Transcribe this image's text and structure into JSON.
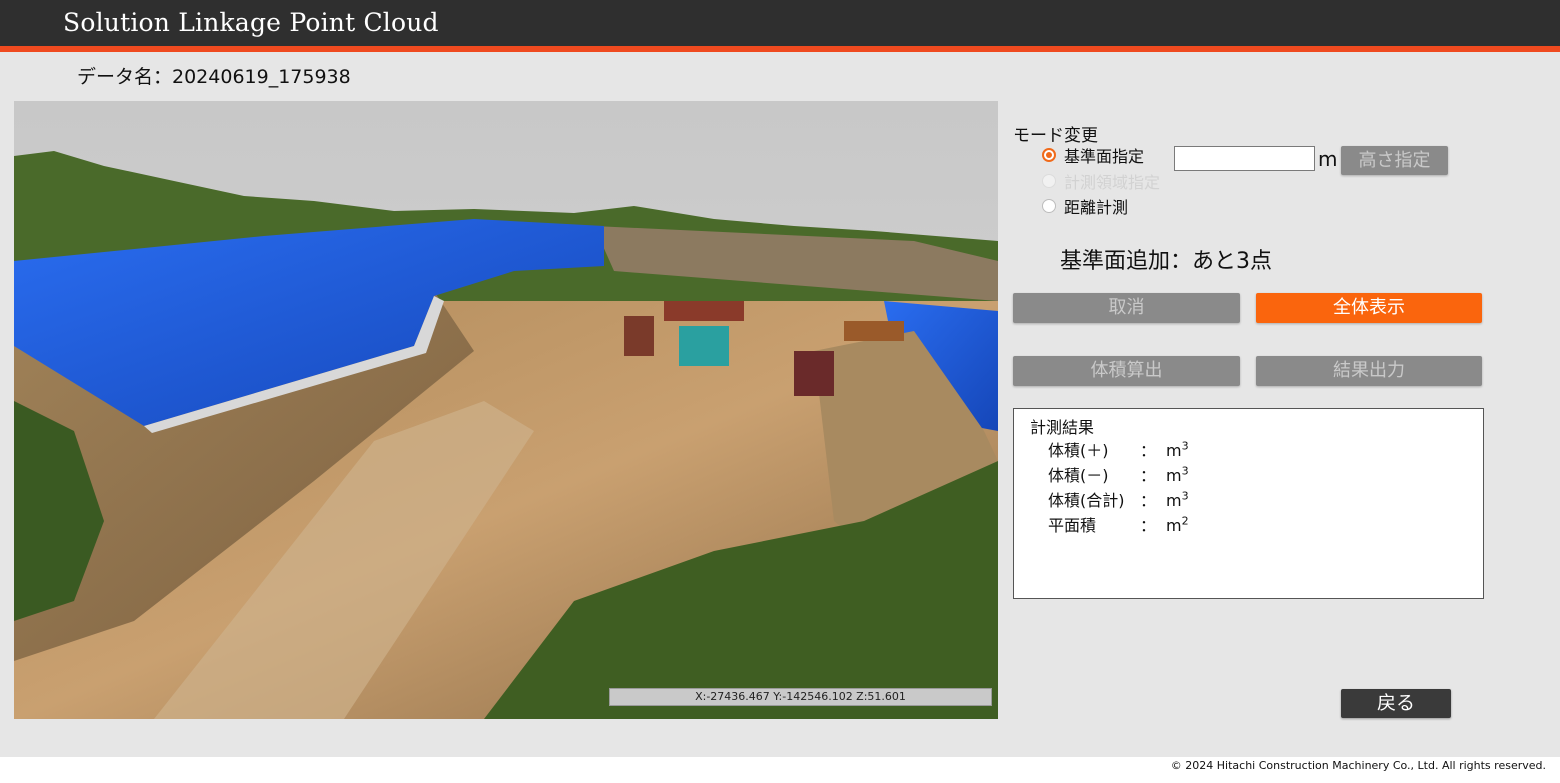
{
  "app": {
    "title": "Solution Linkage Point Cloud"
  },
  "data_name": {
    "label": "データ名：20240619_175938"
  },
  "viewer": {
    "coordinates": "X:-27436.467 Y:-142546.102 Z:51.601"
  },
  "mode": {
    "label": "モード変更",
    "options": [
      {
        "label": "基準面指定",
        "checked": true,
        "enabled": true
      },
      {
        "label": "計測領域指定",
        "checked": false,
        "enabled": false
      },
      {
        "label": "距離計測",
        "checked": false,
        "enabled": true
      }
    ]
  },
  "height": {
    "value": "",
    "unit": "m",
    "button_label": "高さ指定"
  },
  "status": {
    "message": "基準面追加：あと3点"
  },
  "buttons": {
    "cancel": "取消",
    "show_all": "全体表示",
    "volume_calc": "体積算出",
    "export": "結果出力",
    "back": "戻る"
  },
  "results": {
    "title": "計測結果",
    "rows": [
      {
        "label": "体積(＋)",
        "sep": "：",
        "unit": "m",
        "exp": "3"
      },
      {
        "label": "体積(－)",
        "sep": "：",
        "unit": "m",
        "exp": "3"
      },
      {
        "label": "体積(合計)",
        "sep": "：",
        "unit": "m",
        "exp": "3"
      },
      {
        "label": "平面積",
        "sep": "：",
        "unit": "m",
        "exp": "2"
      }
    ]
  },
  "footer": {
    "copyright": "© 2024 Hitachi Construction Machinery Co., Ltd. All rights reserved."
  },
  "colors": {
    "accent": "#fa650d",
    "header": "#2f2f2f",
    "stripe": "#ef4a1f",
    "tarp": "#1f5fe0"
  }
}
